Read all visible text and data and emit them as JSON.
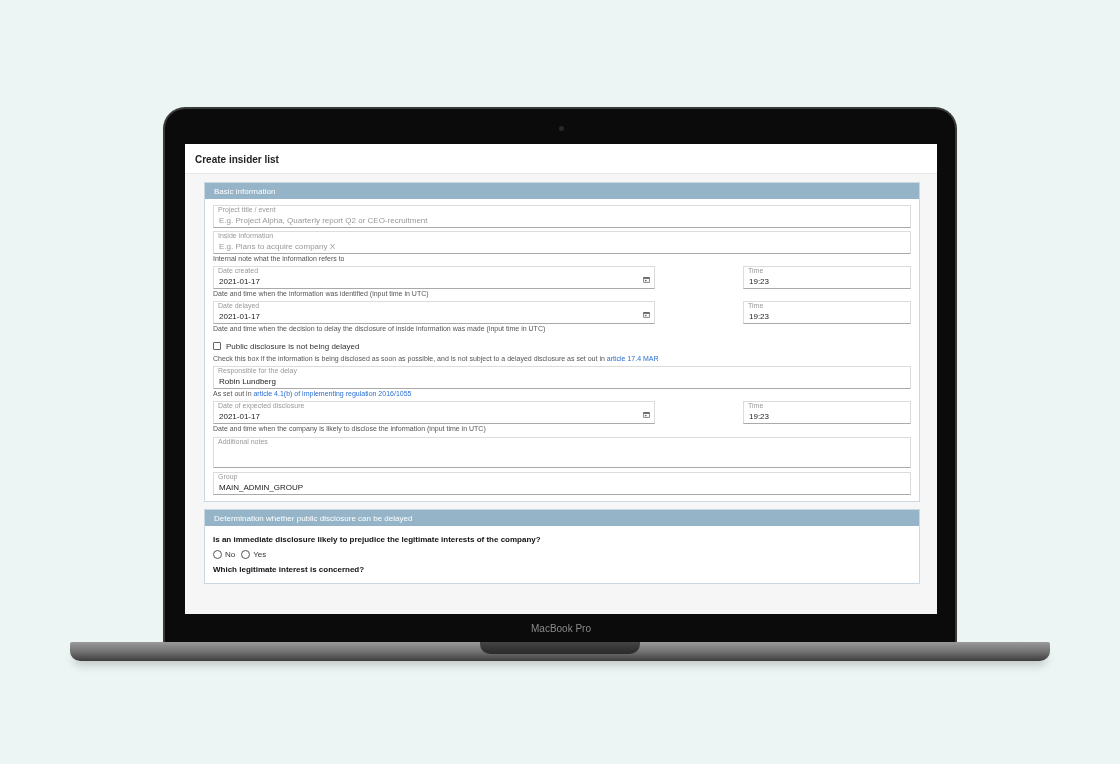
{
  "page": {
    "title": "Create insider list"
  },
  "sections": [
    {
      "title": "Basic information",
      "fields": [
        {
          "kind": "text",
          "label": "Project title / event",
          "placeholder": "E.g. Project Alpha, Quarterly report Q2 or CEO-recruitment"
        },
        {
          "kind": "text",
          "label": "Inside information",
          "placeholder": "E.g. Plans to acquire company X",
          "help": "Internal note what the information refers to"
        },
        {
          "kind": "datetime",
          "label": "Date created",
          "value": "2021-01-17",
          "time_label": "Time",
          "time_value": "19:23",
          "help": "Date and time when the information was identified (input time in UTC)"
        },
        {
          "kind": "datetime",
          "label": "Date delayed",
          "value": "2021-01-17",
          "time_label": "Time",
          "time_value": "19:23",
          "help": "Date and time when the decision to delay the disclosure of inside information was made (input time in UTC)"
        },
        {
          "kind": "checkbox",
          "label": "Public disclosure is not being delayed",
          "checked": false,
          "help": "Check this box if the information is being disclosed as soon as possible, and is not subject to a delayed disclosure as set out in ",
          "help_link": "article 17.4 MAR"
        },
        {
          "kind": "text",
          "label": "Responsible for the delay",
          "value": "Robin Lundberg",
          "help": "As set out in ",
          "help_link": "article 4.1(b) of implementing regulation 2016/1055"
        },
        {
          "kind": "datetime",
          "label": "Date of expected disclosure",
          "value": "2021-01-17",
          "time_label": "Time",
          "time_value": "19:23",
          "help": "Date and time when the company is likely to disclose the information (input time in UTC)"
        },
        {
          "kind": "textarea",
          "label": "Additional notes"
        },
        {
          "kind": "text",
          "label": "Group",
          "value": "MAIN_ADMIN_GROUP"
        }
      ]
    },
    {
      "title": "Determination whether public disclosure can be delayed",
      "fields": [
        {
          "kind": "question",
          "label": "Is an immediate disclosure likely to prejudice the legitimate interests of the company?",
          "options": [
            {
              "label": "No",
              "selected": false
            },
            {
              "label": "Yes",
              "selected": false
            }
          ]
        },
        {
          "kind": "question",
          "label": "Which legitimate interest is concerned?"
        }
      ]
    }
  ],
  "device": {
    "label": "MacBook Pro"
  }
}
